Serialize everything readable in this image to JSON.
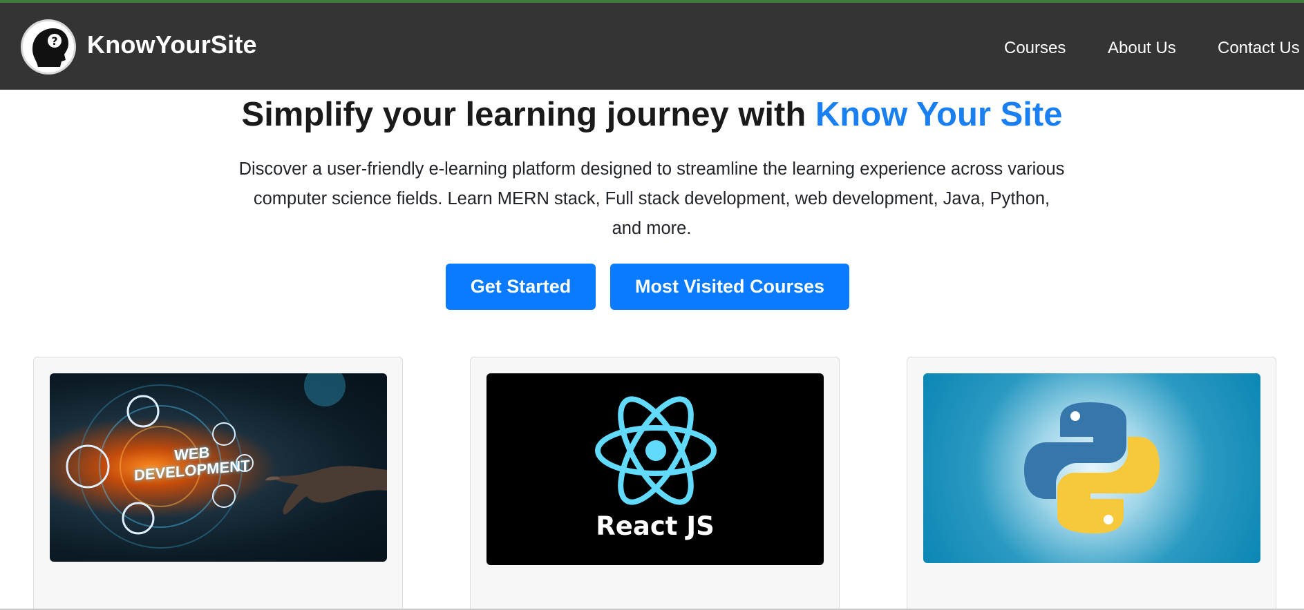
{
  "header": {
    "brand": "KnowYourSite",
    "nav": [
      {
        "label": "Courses"
      },
      {
        "label": "About Us"
      },
      {
        "label": "Contact Us"
      }
    ]
  },
  "hero": {
    "title_prefix": "Simplify your learning journey with ",
    "title_highlight": "Know Your Site",
    "description": "Discover a user-friendly e-learning platform designed to streamline the learning experience across various computer science fields. Learn MERN stack, Full stack development, web development, Java, Python, and more.",
    "buttons": {
      "get_started": "Get Started",
      "most_visited": "Most Visited Courses"
    }
  },
  "courses": [
    {
      "image_text_line1": "WEB",
      "image_text_line2": "DEVELOPMENT",
      "icon": "web-development-icon"
    },
    {
      "image_text": "React JS",
      "icon": "react-logo-icon"
    },
    {
      "icon": "python-logo-icon"
    }
  ],
  "colors": {
    "navbar": "#343434",
    "accent": "#1a7ff0",
    "button": "#0a7bff",
    "top_line": "#3f7d3a"
  }
}
